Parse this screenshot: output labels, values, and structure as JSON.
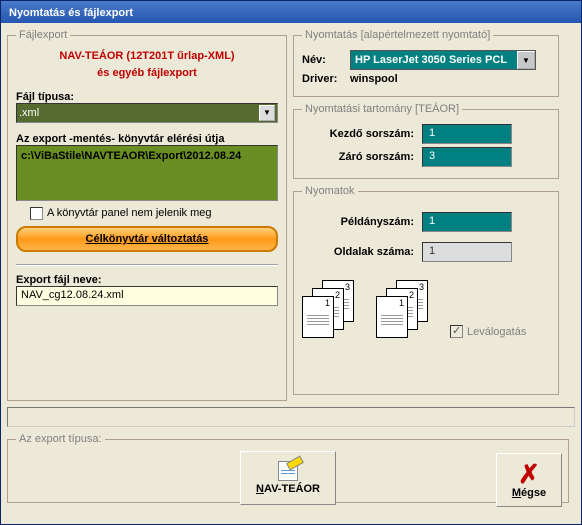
{
  "window": {
    "title": "Nyomtatás és fájlexport"
  },
  "fileexport": {
    "legend": "Fájlexport",
    "title_line1": "NAV-TEÁOR (12T201T űrlap-XML)",
    "title_line2": "és egyéb fájlexport",
    "filetype_label": "Fájl típusa:",
    "filetype_value": ".xml",
    "path_label": "Az export -mentés- könyvtár elérési útja",
    "path_value": "c:\\ViBaStile\\NAVTEAOR\\Export\\2012.08.24",
    "panel_chk_label": "A könyvtár panel nem jelenik meg",
    "change_dir_btn": "Célkönyvtár változtatás",
    "filename_label": "Export fájl neve:",
    "filename_value": "NAV_cg12.08.24.xml"
  },
  "print": {
    "legend": "Nyomtatás [alapértelmezett nyomtató]",
    "name_label": "Név:",
    "name_value": "HP LaserJet 3050 Series PCL",
    "driver_label": "Driver:",
    "driver_value": "winspool"
  },
  "range": {
    "legend": "Nyomtatási tartomány [TEÁOR]",
    "start_label": "Kezdő sorszám:",
    "start_value": "1",
    "end_label": "Záró sorszám:",
    "end_value": "3"
  },
  "copies": {
    "legend": "Nyomatok",
    "copies_label": "Példányszám:",
    "copies_value": "1",
    "pages_label": "Oldalak száma:",
    "pages_value": "1",
    "collate_label": "Leválogatás"
  },
  "bottom": {
    "legend": "Az export típusa:",
    "nav_btn_u": "N",
    "nav_btn_rest": "AV-TEÁOR",
    "cancel_u": "M",
    "cancel_rest": "égse"
  }
}
